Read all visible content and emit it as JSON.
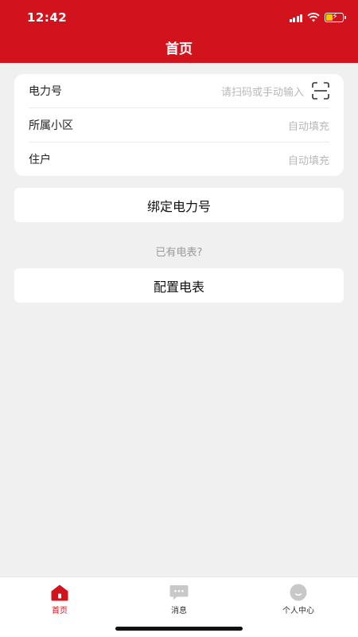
{
  "status": {
    "time": "12:42"
  },
  "header": {
    "title": "首页"
  },
  "form": {
    "rows": [
      {
        "label": "电力号",
        "value": "请扫码或手动输入"
      },
      {
        "label": "所属小区",
        "value": "自动填充"
      },
      {
        "label": "住户",
        "value": "自动填充"
      }
    ]
  },
  "actions": {
    "bind_label": "绑定电力号",
    "hint": "已有电表?",
    "config_label": "配置电表"
  },
  "tabbar": {
    "items": [
      {
        "label": "首页",
        "icon": "home-icon",
        "active": true
      },
      {
        "label": "消息",
        "icon": "message-icon",
        "active": false
      },
      {
        "label": "个人中心",
        "icon": "profile-icon",
        "active": false
      }
    ]
  },
  "colors": {
    "brand": "#d0131c",
    "background": "#f0f0f0"
  }
}
